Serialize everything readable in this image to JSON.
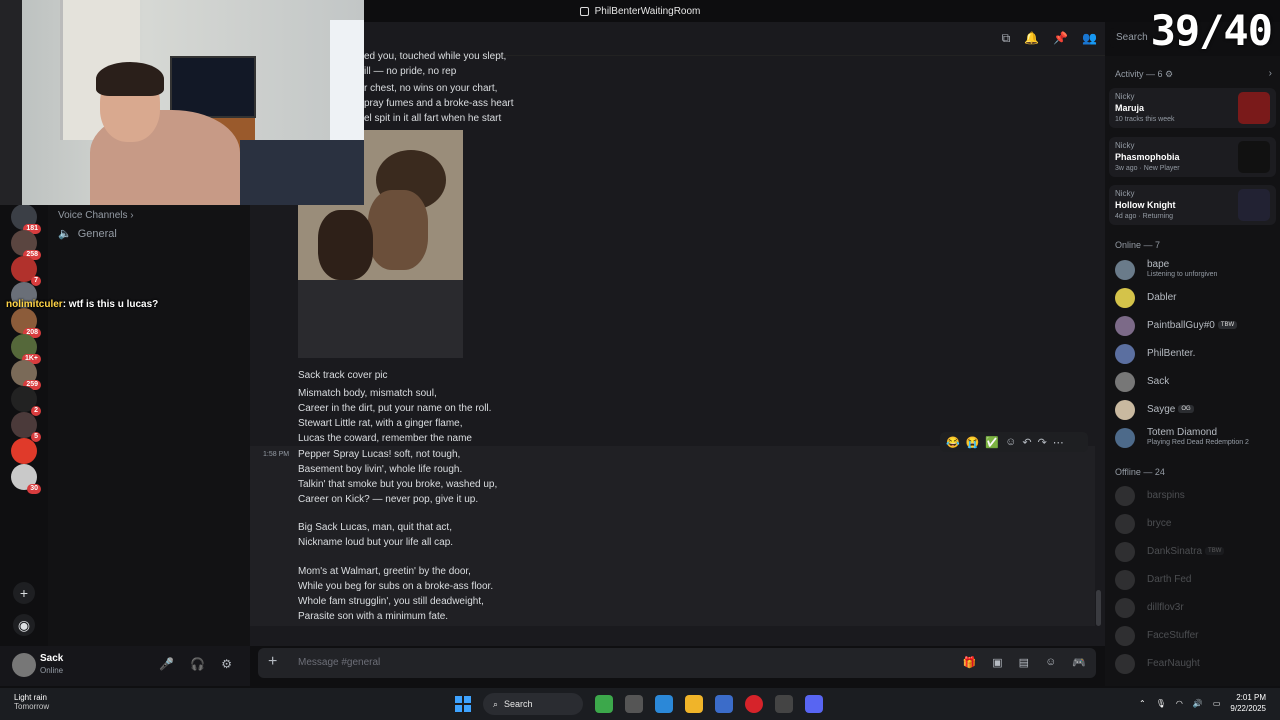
{
  "window": {
    "title": "PhilBenterWaitingRoom"
  },
  "overlay_counter": "39/40",
  "search": {
    "placeholder": "Search"
  },
  "channels": {
    "section": "Voice Channels",
    "voice": "General"
  },
  "servers": {
    "badges": [
      "181",
      "258",
      "7",
      "",
      "208",
      "1K+",
      "259",
      "2",
      "5",
      "",
      "30"
    ],
    "colors": [
      "#3b3f46",
      "#5a4540",
      "#b1312c",
      "#6a6f78",
      "#8c5c3a",
      "#55683a",
      "#7a6a58",
      "#222",
      "#4b3a3a",
      "#e03a2a",
      "#c9c9c9"
    ]
  },
  "stream_chat": {
    "user": "nolimitculer",
    "text": ": wtf is this u lucas?"
  },
  "messages": {
    "top_lines": [
      "ed you, touched while you slept,",
      "ill — no pride, no rep",
      "r chest, no wins on your chart,",
      "pray fumes and a broke-ass heart",
      "el spit in it all fart when he start"
    ],
    "caption": "Sack track cover pic",
    "block1": [
      "Mismatch body, mismatch soul,",
      "Career in the dirt, put your name on the roll.",
      "Stewart Little rat, with a ginger flame,",
      "Lucas the coward, remember the name"
    ],
    "timestamp": "1:58 PM",
    "block2": [
      "Pepper Spray Lucas! soft, not tough,",
      "Basement boy livin', whole life rough.",
      "Talkin' that smoke but you broke, washed up,",
      "Career on Kick? — never pop, give it up."
    ],
    "block3": [
      "Big Sack Lucas, man, quit that act,",
      "Nickname loud but your life all cap."
    ],
    "block4": [
      "Mom's at Walmart, greetin' by the door,",
      "While you beg for subs on a broke-ass floor.",
      "Whole fam strugglin', you still deadweight,",
      "Parasite son with a minimum fate."
    ]
  },
  "composer": {
    "placeholder": "Message #general"
  },
  "user": {
    "name": "Sack",
    "status": "Online"
  },
  "activity": {
    "header": "Activity — 6",
    "cards": [
      {
        "who": "Nicky",
        "game": "Maruja",
        "meta": "10 tracks this week",
        "color": "#7a1a1a"
      },
      {
        "who": "Nicky",
        "game": "Phasmophobia",
        "meta": "3w ago · New Player",
        "color": "#111"
      },
      {
        "who": "Nicky",
        "game": "Hollow Knight",
        "meta": "4d ago · Returning",
        "color": "#223"
      }
    ]
  },
  "online": {
    "header": "Online — 7",
    "members": [
      {
        "name": "bape",
        "sub": "Listening to unforgiven",
        "tag": "",
        "color": "#6a7b8a"
      },
      {
        "name": "Dabler",
        "sub": "",
        "tag": "",
        "color": "#d4c34a"
      },
      {
        "name": "PaintballGuy#0",
        "sub": "",
        "tag": "TBW",
        "color": "#7c6a88"
      },
      {
        "name": "PhilBenter.",
        "sub": "",
        "tag": "",
        "color": "#5b6fa0"
      },
      {
        "name": "Sack",
        "sub": "",
        "tag": "",
        "color": "#777"
      },
      {
        "name": "Sayge",
        "sub": "",
        "tag": "OG",
        "color": "#c9b9a0"
      },
      {
        "name": "Totem Diamond",
        "sub": "Playing Red Dead Redemption 2",
        "tag": "",
        "color": "#4d6a8a"
      }
    ]
  },
  "offline": {
    "header": "Offline — 24",
    "members": [
      {
        "name": "barspins",
        "tag": ""
      },
      {
        "name": "bryce",
        "tag": ""
      },
      {
        "name": "DankSinatra",
        "tag": "TBW"
      },
      {
        "name": "Darth Fed",
        "tag": ""
      },
      {
        "name": "dillflov3r",
        "tag": ""
      },
      {
        "name": "FaceStuffer",
        "tag": ""
      },
      {
        "name": "FearNaught",
        "tag": ""
      }
    ]
  },
  "taskbar": {
    "weather_1": "Light rain",
    "weather_2": "Tomorrow",
    "search": "Search",
    "time": "2:01 PM",
    "date": "9/22/2025"
  }
}
